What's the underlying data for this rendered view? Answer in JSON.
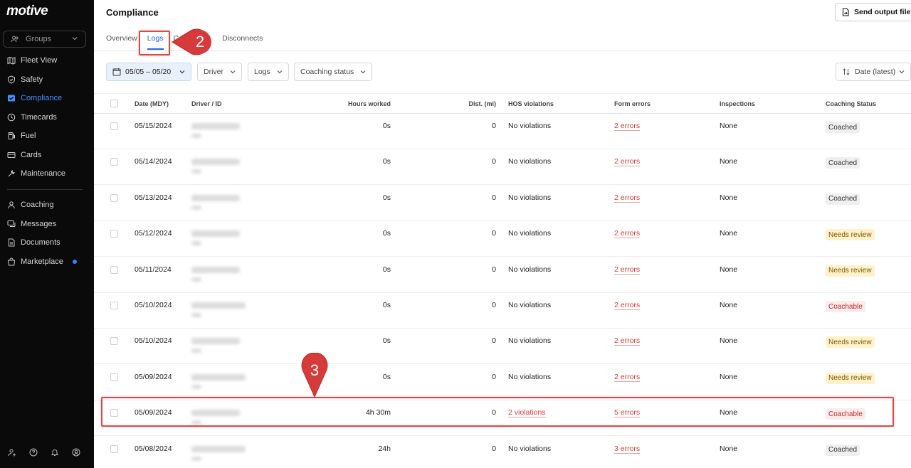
{
  "sidebar": {
    "logo": "motive",
    "groups_label": "Groups",
    "nav_top": [
      {
        "label": "Fleet View",
        "icon": "map-icon"
      },
      {
        "label": "Safety",
        "icon": "shield-icon"
      },
      {
        "label": "Compliance",
        "icon": "compliance-icon",
        "active": true
      },
      {
        "label": "Timecards",
        "icon": "clock-icon"
      },
      {
        "label": "Fuel",
        "icon": "fuel-icon"
      },
      {
        "label": "Cards",
        "icon": "card-icon"
      },
      {
        "label": "Maintenance",
        "icon": "wrench-icon"
      }
    ],
    "nav_bottom": [
      {
        "label": "Coaching",
        "icon": "coaching-icon"
      },
      {
        "label": "Messages",
        "icon": "messages-icon"
      },
      {
        "label": "Documents",
        "icon": "documents-icon"
      },
      {
        "label": "Marketplace",
        "icon": "marketplace-icon"
      }
    ]
  },
  "header": {
    "title": "Compliance",
    "send_button": "Send output file"
  },
  "tabs": [
    {
      "label": "Overview"
    },
    {
      "label": "Logs",
      "active": true
    },
    {
      "label": "C"
    },
    {
      "label": "Disconnects"
    }
  ],
  "filters": {
    "date_range": "05/05 – 05/20",
    "driver": "Driver",
    "logs": "Logs",
    "coaching_status": "Coaching status",
    "sort": "Date (latest)"
  },
  "table": {
    "headers": [
      "Date (MDY)",
      "Driver / ID",
      "Hours worked",
      "Dist. (mi)",
      "HOS violations",
      "Form errors",
      "Inspections",
      "Coaching Status"
    ],
    "rows": [
      {
        "date": "05/15/2024",
        "hours": "0s",
        "dist": "0",
        "hos": "No violations",
        "hos_link": false,
        "errors": "2 errors",
        "inspections": "None",
        "status": "Coached",
        "status_type": "coached"
      },
      {
        "date": "05/14/2024",
        "hours": "0s",
        "dist": "0",
        "hos": "No violations",
        "hos_link": false,
        "errors": "2 errors",
        "inspections": "None",
        "status": "Coached",
        "status_type": "coached"
      },
      {
        "date": "05/13/2024",
        "hours": "0s",
        "dist": "0",
        "hos": "No violations",
        "hos_link": false,
        "errors": "2 errors",
        "inspections": "None",
        "status": "Coached",
        "status_type": "coached"
      },
      {
        "date": "05/12/2024",
        "hours": "0s",
        "dist": "0",
        "hos": "No violations",
        "hos_link": false,
        "errors": "2 errors",
        "inspections": "None",
        "status": "Needs review",
        "status_type": "review"
      },
      {
        "date": "05/11/2024",
        "hours": "0s",
        "dist": "0",
        "hos": "No violations",
        "hos_link": false,
        "errors": "2 errors",
        "inspections": "None",
        "status": "Needs review",
        "status_type": "review"
      },
      {
        "date": "05/10/2024",
        "hours": "0s",
        "dist": "0",
        "hos": "No violations",
        "hos_link": false,
        "errors": "2 errors",
        "inspections": "None",
        "status": "Coachable",
        "status_type": "coachable"
      },
      {
        "date": "05/10/2024",
        "hours": "0s",
        "dist": "0",
        "hos": "No violations",
        "hos_link": false,
        "errors": "2 errors",
        "inspections": "None",
        "status": "Needs review",
        "status_type": "review"
      },
      {
        "date": "05/09/2024",
        "hours": "0s",
        "dist": "0",
        "hos": "No violations",
        "hos_link": false,
        "errors": "2 errors",
        "inspections": "None",
        "status": "Needs review",
        "status_type": "review"
      },
      {
        "date": "05/09/2024",
        "hours": "4h 30m",
        "dist": "0",
        "hos": "2 violations",
        "hos_link": true,
        "errors": "5 errors",
        "inspections": "None",
        "status": "Coachable",
        "status_type": "coachable"
      },
      {
        "date": "05/08/2024",
        "hours": "24h",
        "dist": "0",
        "hos": "No violations",
        "hos_link": false,
        "errors": "3 errors",
        "inspections": "None",
        "status": "Coached",
        "status_type": "coached"
      }
    ]
  },
  "annotations": [
    {
      "label": "2"
    },
    {
      "label": "3"
    }
  ],
  "colors": {
    "accent": "#2563eb",
    "annotation": "#e04848",
    "sidebar_bg": "#0a0a0a",
    "error": "#d73b3b"
  }
}
